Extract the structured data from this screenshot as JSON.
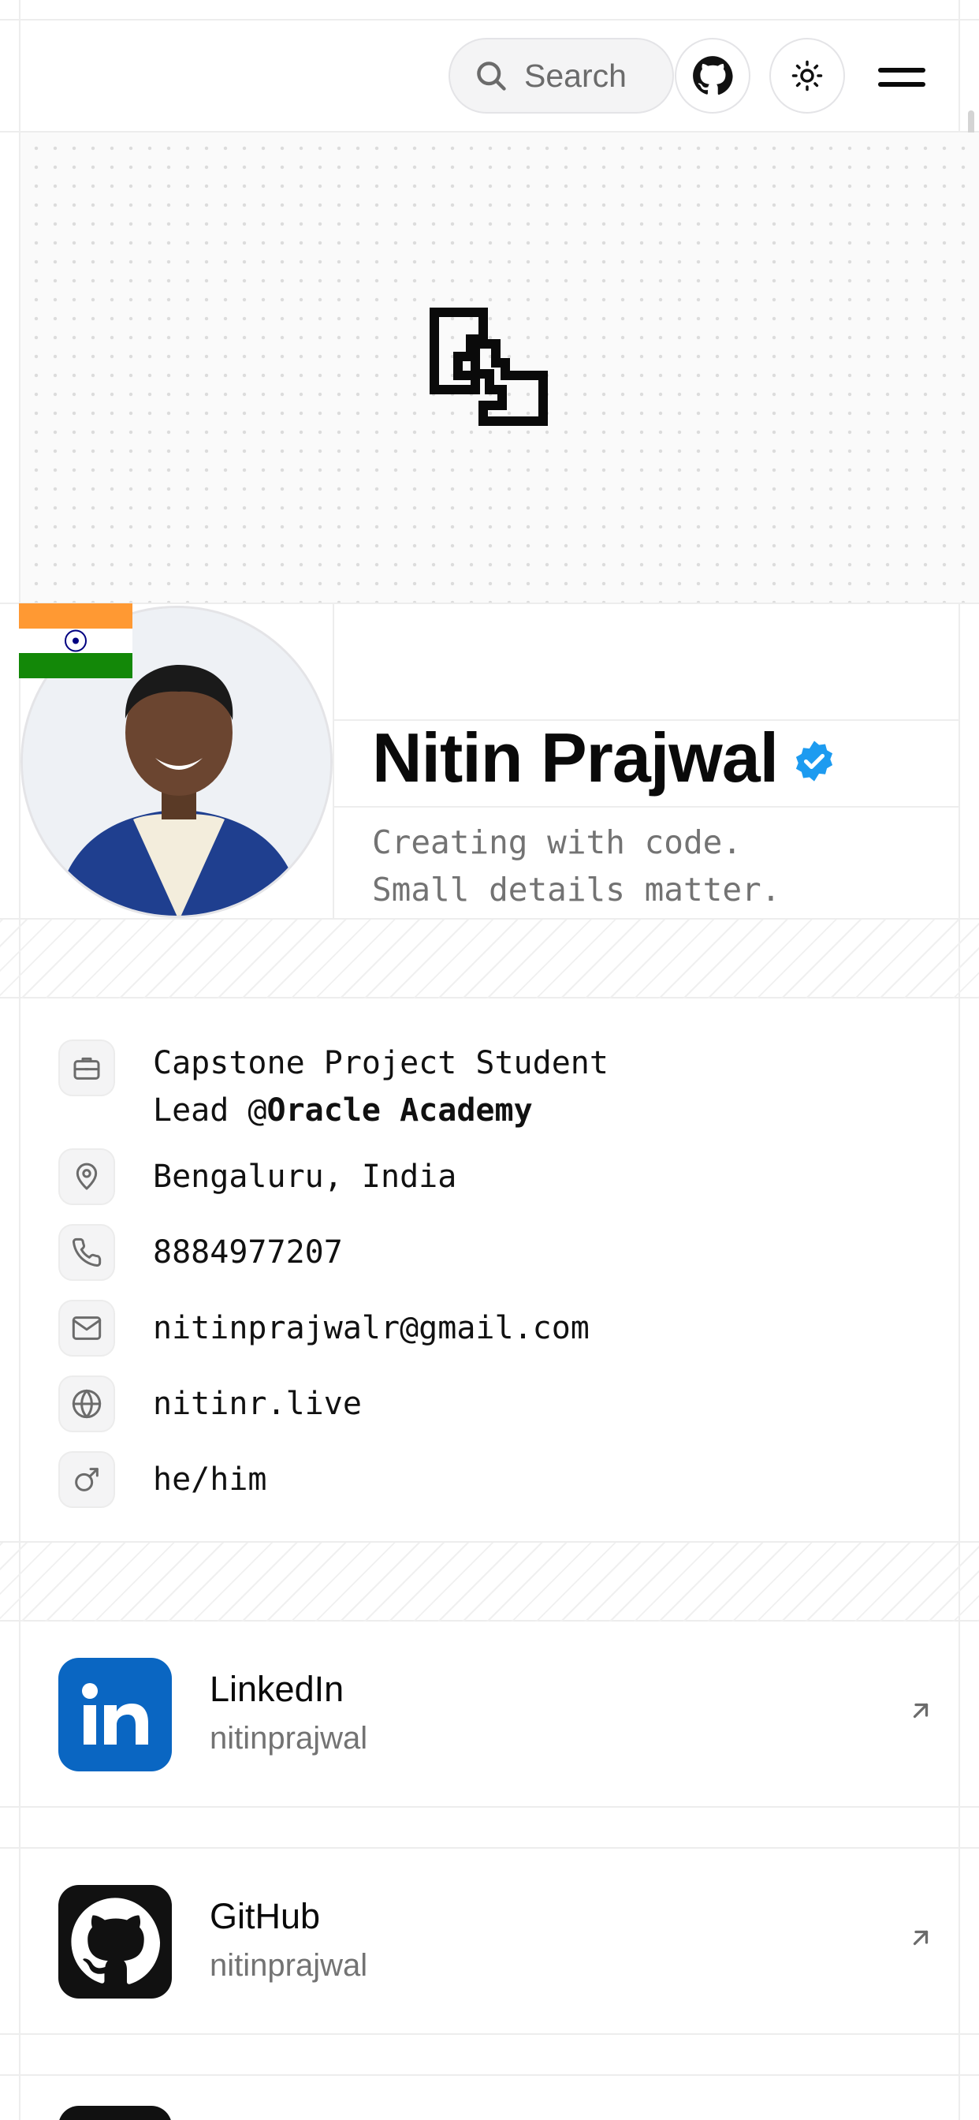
{
  "header": {
    "search_label": "Search",
    "github_icon": "github-icon",
    "theme_icon": "sun-icon",
    "menu_icon": "hamburger-menu-icon"
  },
  "hero": {
    "logo_icon": "brand-logo-icon"
  },
  "profile": {
    "name": "Nitin Prajwal",
    "verified_icon": "verified-badge-icon",
    "tagline_line1": "Creating with code.",
    "tagline_line2": "Small details matter.",
    "flag_icon": "india-flag-icon"
  },
  "info": {
    "job_line1": "Capstone Project Student",
    "job_line2_prefix": "Lead @",
    "job_line2_org": "Oracle Academy",
    "location": "Bengaluru, India",
    "phone": "8884977207",
    "email": "nitinprajwalr@gmail.com",
    "website": "nitinr.live",
    "pronouns": "he/him"
  },
  "social": [
    {
      "title": "LinkedIn",
      "handle": "nitinprajwal",
      "color": "#0a66c2"
    },
    {
      "title": "GitHub",
      "handle": "nitinprajwal",
      "color": "#111111"
    }
  ]
}
